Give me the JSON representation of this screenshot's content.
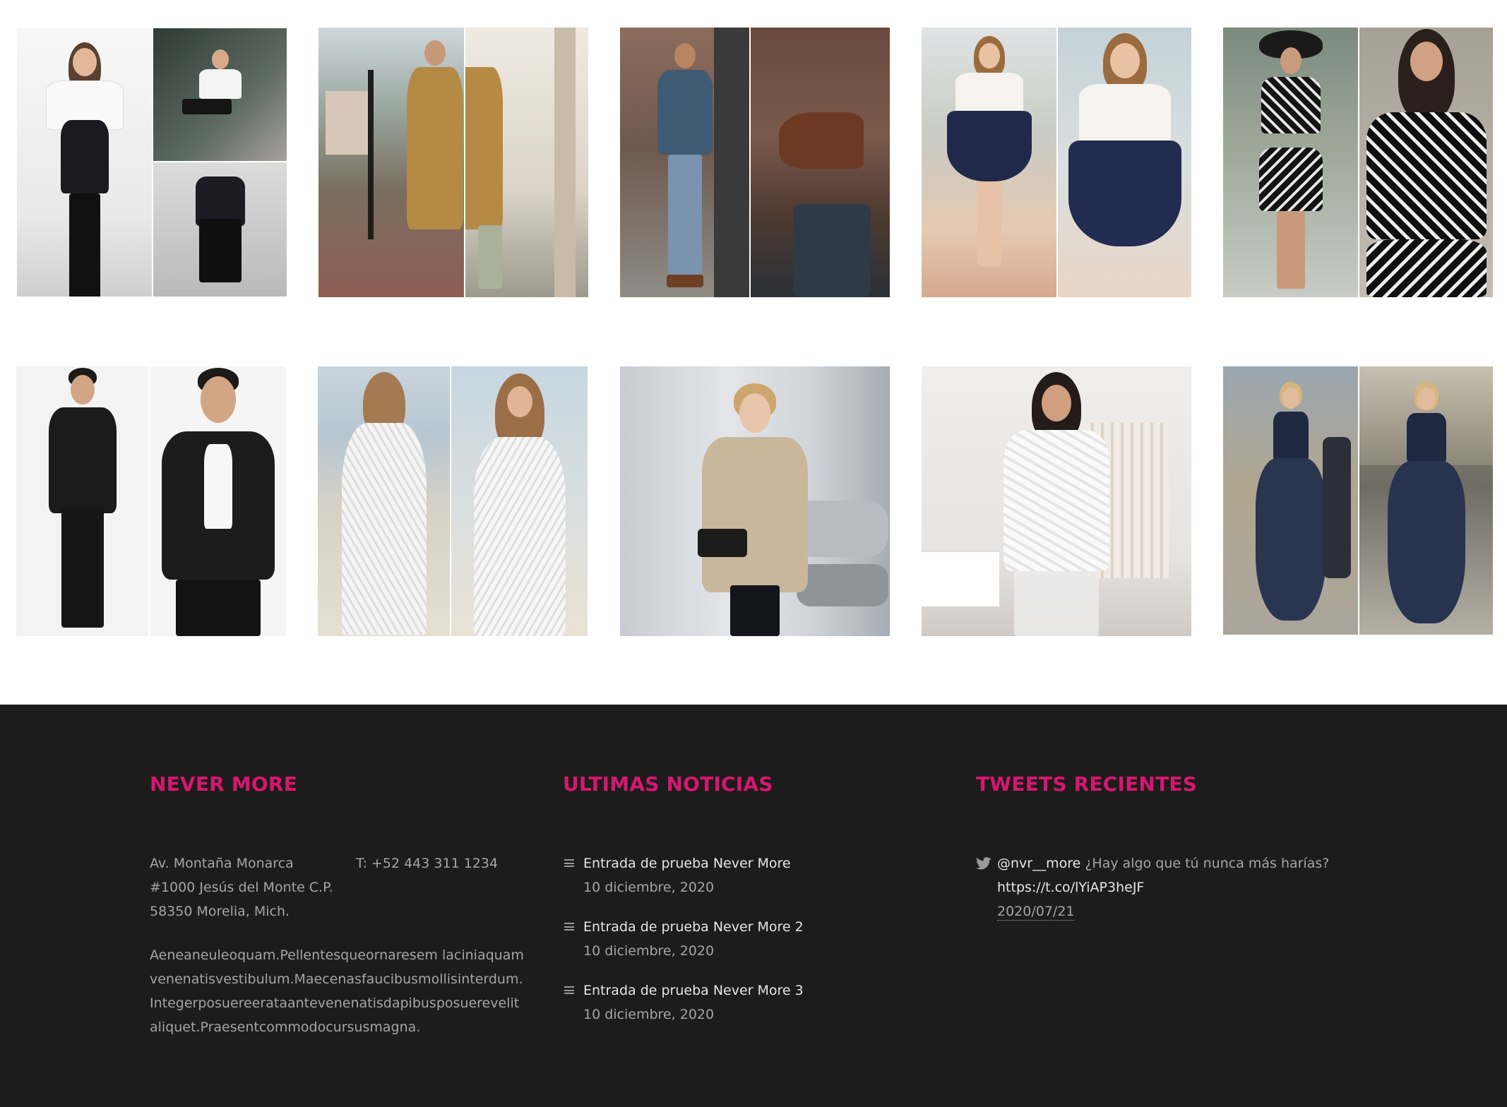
{
  "gallery": {
    "items": [
      {
        "name": "gallery-photo-off-shoulder-pinafore"
      },
      {
        "name": "gallery-photo-camel-trench-coat"
      },
      {
        "name": "gallery-photo-blue-blazer-boots"
      },
      {
        "name": "gallery-photo-white-top-navy-skirt"
      },
      {
        "name": "gallery-photo-embroidered-crop-set"
      },
      {
        "name": "gallery-photo-leather-jacket-bowtie"
      },
      {
        "name": "gallery-photo-white-lace-dress"
      },
      {
        "name": "gallery-photo-beige-field-jacket"
      },
      {
        "name": "gallery-photo-white-feather-jacket"
      },
      {
        "name": "gallery-photo-navy-ball-gown"
      }
    ]
  },
  "footer": {
    "about": {
      "heading": "NEVER MORE",
      "address_lines": [
        "Av. Montaña Monarca",
        "#1000 Jesús del Monte C.P.",
        "58350 Morelia, Mich."
      ],
      "phone": "T: +52 443 311 1234",
      "description_lines": [
        "Aeneaneuleoquam.Pellentesqueornaresem laciniaquam",
        "venenatisvestibulum.Maecenasfaucibusmollisinterdum.",
        "Integerposuereerataantevenenatisdapibusposuerevelit",
        "aliquet.Praesentcommodocursusmagna."
      ]
    },
    "news": {
      "heading": "ULTIMAS NOTICIAS",
      "items": [
        {
          "title": "Entrada de prueba Never More",
          "date": "10 diciembre, 2020"
        },
        {
          "title": "Entrada de prueba Never More 2",
          "date": "10 diciembre, 2020"
        },
        {
          "title": "Entrada de prueba Never More 3",
          "date": "10 diciembre, 2020"
        }
      ]
    },
    "tweets": {
      "heading": "TWEETS RECIENTES",
      "icon": "twitter-bird-icon",
      "user": "@nvr__more",
      "text": "¿Hay algo que tú nunca más harías?",
      "link": "https://t.co/lYiAP3heJF",
      "date": "2020/07/21"
    },
    "colors": {
      "background": "#1c1c1c",
      "accent": "#d6176f",
      "text": "#a5a5a5",
      "link": "#e6e6e6"
    }
  }
}
